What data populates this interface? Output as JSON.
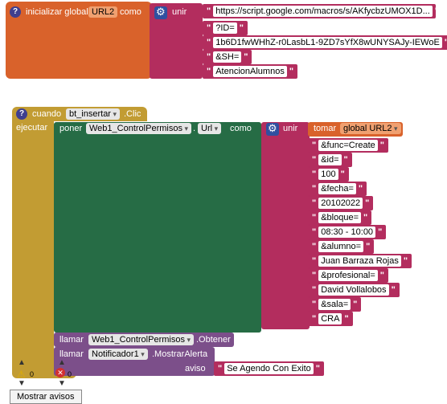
{
  "global_block": {
    "init_label": "inicializar global",
    "var_name": "URL2",
    "como": "como",
    "join_label": "unir",
    "strings": [
      "https://script.google.com/macros/s/AKfycbzUMOX1D...",
      "?ID=",
      "1b6D1fwWHhZ-r0LasbL1-9ZD7sYfX8wUNYSAJy-IEWoE",
      "&SH=",
      "AtencionAlumnos"
    ]
  },
  "event_block": {
    "when_label": "cuando",
    "component": "bt_insertar",
    "event": ".Clic",
    "do_label": "ejecutar",
    "set_label": "poner",
    "set_component": "Web1_ControlPermisos",
    "set_property": "Url",
    "set_como": "como",
    "join_label": "unir",
    "get_label": "tomar",
    "get_var": "global URL2",
    "strings": [
      "&func=Create",
      "&id=",
      "100",
      "&fecha=",
      "20102022",
      "&bloque=",
      "08:30 - 10:00",
      "&alumno=",
      "Juan Barraza Rojas",
      "&profesional=",
      "David Vollalobos",
      "&sala=",
      "CRA"
    ],
    "call1_label": "llamar",
    "call1_component": "Web1_ControlPermisos",
    "call1_method": ".Obtener",
    "call2_label": "llamar",
    "call2_component": "Notificador1",
    "call2_method": ".MostrarAlerta",
    "aviso_label": "aviso",
    "aviso_value": "Se Agendo Con Exito"
  },
  "warnings": {
    "warning_count": "0",
    "error_count": "0",
    "toggle_label": "Mostrar avisos"
  }
}
